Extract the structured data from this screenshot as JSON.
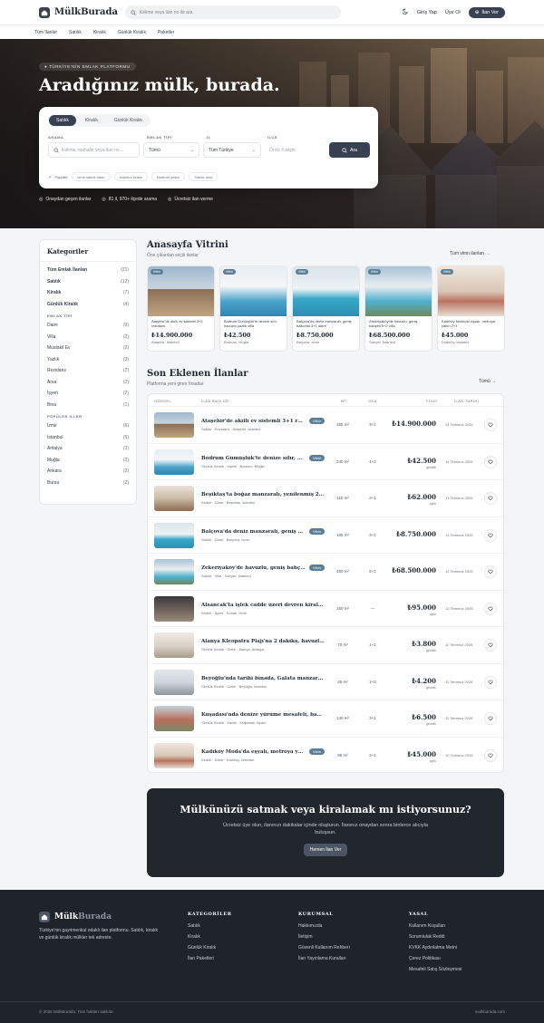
{
  "header": {
    "brand": "MülkBurada",
    "search_placeholder": "Kelime veya ilan no ile ara",
    "login": "Giriş Yap",
    "signup": "Üye Ol",
    "post": "İlan Ver"
  },
  "nav": [
    "Tüm İlanlar",
    "Satılık",
    "Kiralık",
    "Günlük Kiralık",
    "Paketler"
  ],
  "hero": {
    "eyebrow": "● TÜRKİYE'NİN EMLAK PLATFORMU",
    "title": "Aradığınız mülk, burada.",
    "tabs": [
      "Satılık",
      "Kiralık",
      "Günlük Kiralık"
    ],
    "labels": {
      "search": "ARAMA",
      "type": "EMLAK TİPİ",
      "city": "İL",
      "district": "İLÇE"
    },
    "search_placeholder": "Kelime, mahalle veya ilan no...",
    "type_value": "Tümü",
    "city_value": "Tüm Türkiye",
    "district_placeholder": "Önce il seçin",
    "submit": "Ara",
    "popular_label": "Popüler:",
    "popular": [
      "İzmir satılık daire",
      "İstanbul kiralık",
      "Bodrum yazlık",
      "Satılık arsa"
    ],
    "features": [
      "Onaydan geçen ilanlar",
      "81 il, 970+ ilçede arama",
      "Ücretsiz ilan verme"
    ]
  },
  "sidebar": {
    "title": "Kategoriler",
    "main": [
      {
        "label": "Tüm Emlak İlanları",
        "count": "(21)"
      },
      {
        "label": "Satılık",
        "count": "(12)"
      },
      {
        "label": "Kiralık",
        "count": "(7)"
      },
      {
        "label": "Günlük Kiralık",
        "count": "(4)"
      }
    ],
    "type_title": "EMLAK TİPİ",
    "types": [
      {
        "label": "Daire",
        "count": "(9)"
      },
      {
        "label": "Villa",
        "count": "(2)"
      },
      {
        "label": "Müstakil Ev",
        "count": "(2)"
      },
      {
        "label": "Yazlık",
        "count": "(3)"
      },
      {
        "label": "Rezidans",
        "count": "(2)"
      },
      {
        "label": "Arsa",
        "count": "(2)"
      },
      {
        "label": "İşyeri",
        "count": "(2)"
      },
      {
        "label": "Bina",
        "count": "(1)"
      }
    ],
    "city_title": "POPÜLER İLLER",
    "cities": [
      {
        "label": "İzmir",
        "count": "(6)"
      },
      {
        "label": "İstanbul",
        "count": "(5)"
      },
      {
        "label": "Antalya",
        "count": "(3)"
      },
      {
        "label": "Muğla",
        "count": "(2)"
      },
      {
        "label": "Ankara",
        "count": "(2)"
      },
      {
        "label": "Bursa",
        "count": "(2)"
      }
    ]
  },
  "vitrin": {
    "title": "Anasayfa Vitrini",
    "subtitle": "Öne çıkarılan seçili ilanlar",
    "link": "Tüm vitrin ilanları",
    "cards": [
      {
        "badge": "Vitrin",
        "title": "Ataşehir'de akıllı ev sistemli 3+1 rezidans",
        "price": "₺14.900.000",
        "loc": "Ataşehir, İstanbul"
      },
      {
        "badge": "Vitrin",
        "title": "Bodrum Gümüşlük'te denize sıfır, havuzlu yazlık villa",
        "price": "₺42.500",
        "loc": "Bodrum, Muğla"
      },
      {
        "badge": "Vitrin",
        "title": "Balçova'da deniz manzaralı, geniş balkonlu 3+1 daire",
        "price": "₺8.750.000",
        "loc": "Balçova, İzmir"
      },
      {
        "badge": "Vitrin",
        "title": "Zekeriyaköy'de havuzlu, geniş bahçeli 5+2 villa",
        "price": "₺68.500.000",
        "loc": "Sarıyer, İstanbul"
      },
      {
        "badge": "Vitrin",
        "title": "Kadıköy Moda'da eşyalı, metroya yakın 2+1",
        "price": "₺45.000",
        "loc": "Kadıköy, İstanbul"
      }
    ]
  },
  "latest": {
    "title": "Son Eklenen İlanlar",
    "subtitle": "Platforma yeni giren fırsatlar",
    "link": "Tümü",
    "headers": [
      "GÖRSEL",
      "İLAN BAŞLIĞI",
      "M²",
      "ODA",
      "FİYAT",
      "İLAN TARİHİ"
    ],
    "rows": [
      {
        "title": "Ataşehir'de akıllı ev sistemli 3+1 rezidans",
        "badge": "Vitrin",
        "sub": "Satılık · Rezidans · Ataşehir, İstanbul",
        "m2": "165 m²",
        "oda": "3+1",
        "price": "₺14.900.000",
        "per": "",
        "date": "14 Temmuz 2026"
      },
      {
        "title": "Bodrum Gümüşlük'te denize sıfır, havuzlu yazlık villa",
        "badge": "Vitrin",
        "sub": "Günlük Kiralık · Yazlık · Bodrum, Muğla",
        "m2": "240 m²",
        "oda": "4+2",
        "price": "₺42.500",
        "per": "gecelik",
        "date": "14 Temmuz 2026"
      },
      {
        "title": "Beşiktaş'ta boğaz manzaralı, yenilenmiş 2+1",
        "badge": "",
        "sub": "Kiralık · Daire · Beşiktaş, İstanbul",
        "m2": "110 m²",
        "oda": "2+1",
        "price": "₺62.000",
        "per": "aylık",
        "date": "13 Temmuz 2026"
      },
      {
        "title": "Balçova'da deniz manzaralı, geniş balkonlu 3+1 daire",
        "badge": "Vitrin",
        "sub": "Satılık · Daire · Balçova, İzmir",
        "m2": "165 m²",
        "oda": "3+1",
        "price": "₺8.750.000",
        "per": "",
        "date": "13 Temmuz 2026"
      },
      {
        "title": "Zekeriyaköy'de havuzlu, geniş bahçeli 5+2 villa",
        "badge": "Vitrin",
        "sub": "Satılık · Villa · Sarıyer, İstanbul",
        "m2": "480 m²",
        "oda": "5+2",
        "price": "₺68.500.000",
        "per": "",
        "date": "12 Temmuz 2026"
      },
      {
        "title": "Alsancak'ta işlek cadde üzeri devren kiralık dükkan",
        "badge": "",
        "sub": "Kiralık · İşyeri · Konak, İzmir",
        "m2": "150 m²",
        "oda": "—",
        "price": "₺95.000",
        "per": "aylık",
        "date": "12 Temmuz 2026"
      },
      {
        "title": "Alanya Kleopatra Plajı'na 2 dakika, havuzlu sitede 1+1",
        "badge": "",
        "sub": "Günlük Kiralık · Daire · Alanya, Antalya",
        "m2": "70 m²",
        "oda": "1+1",
        "price": "₺3.800",
        "per": "gecelik",
        "date": "11 Temmuz 2026"
      },
      {
        "title": "Beyoğlu'nda tarihi binada, Galata manzaralı stüdyo",
        "badge": "",
        "sub": "Günlük Kiralık · Daire · Beyoğlu, İstanbul",
        "m2": "45 m²",
        "oda": "1+0",
        "price": "₺4.200",
        "per": "gecelik",
        "date": "11 Temmuz 2026"
      },
      {
        "title": "Kuşadası'nda denize yürüme mesafeli, bahçeli taş ev",
        "badge": "",
        "sub": "Günlük Kiralık · Yazlık · Kuşadası, Aydın",
        "m2": "140 m²",
        "oda": "3+1",
        "price": "₺6.500",
        "per": "gecelik",
        "date": "11 Temmuz 2026"
      },
      {
        "title": "Kadıköy Moda'da eşyalı, metroya yakın 2+1",
        "badge": "Vitrin",
        "sub": "Kiralık · Daire · Kadıköy, İstanbul",
        "m2": "95 m²",
        "oda": "2+1",
        "price": "₺45.000",
        "per": "aylık",
        "date": "10 Temmuz 2026"
      }
    ]
  },
  "cta": {
    "title": "Mülkünüzü satmak veya kiralamak mı istiyorsunuz?",
    "text": "Ücretsiz üye olun, ilanınızı dakikalar içinde oluşturun. İlanınız onaydan sonra binlerce alıcıyla buluşsun.",
    "button": "Hemen İlan Ver"
  },
  "footer": {
    "brand_a": "Mülk",
    "brand_b": "Burada",
    "desc": "Türkiye'nin gayrimenkul odaklı ilan platformu. Satılık, kiralık ve günlük kiralık mülkler tek adreste.",
    "cols": [
      {
        "title": "KATEGORİLER",
        "items": [
          "Satılık",
          "Kiralık",
          "Günlük Kiralık",
          "İlan Paketleri"
        ]
      },
      {
        "title": "KURUMSAL",
        "items": [
          "Hakkımızda",
          "İletişim",
          "Güvenli Kullanım Rehberi",
          "İlan Yayınlama Kuralları"
        ]
      },
      {
        "title": "YASAL",
        "items": [
          "Kullanım Koşulları",
          "Sorumluluk Reddi",
          "KVKK Aydınlatma Metni",
          "Çerez Politikası",
          "Mesafeli Satış Sözleşmesi"
        ]
      }
    ],
    "copyright": "© 2026 MülkBurada. Tüm hakları saklıdır.",
    "domain": "mulkburada.com"
  },
  "colors": {
    "accent": "#374151",
    "badge": "#5b7f97",
    "footer": "#1f242b"
  }
}
